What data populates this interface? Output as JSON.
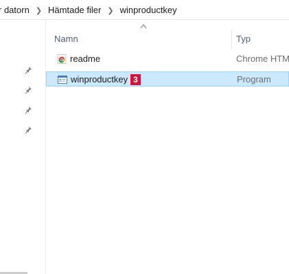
{
  "addressbar": {
    "crumbs": [
      "r datorn",
      "Hämtade filer",
      "winproductkey"
    ]
  },
  "columns": {
    "name": "Namn",
    "type": "Typ"
  },
  "files": [
    {
      "name": "readme",
      "type": "Chrome HTML",
      "icon": "chrome-icon",
      "selected": false
    },
    {
      "name": "winproductkey",
      "type": "Program",
      "icon": "program-icon",
      "selected": true
    }
  ],
  "badge": "3",
  "colors": {
    "selection": "#cce8ff",
    "selection_border": "#99d1ff",
    "badge": "#d0143a",
    "header_text": "#4c607a"
  }
}
